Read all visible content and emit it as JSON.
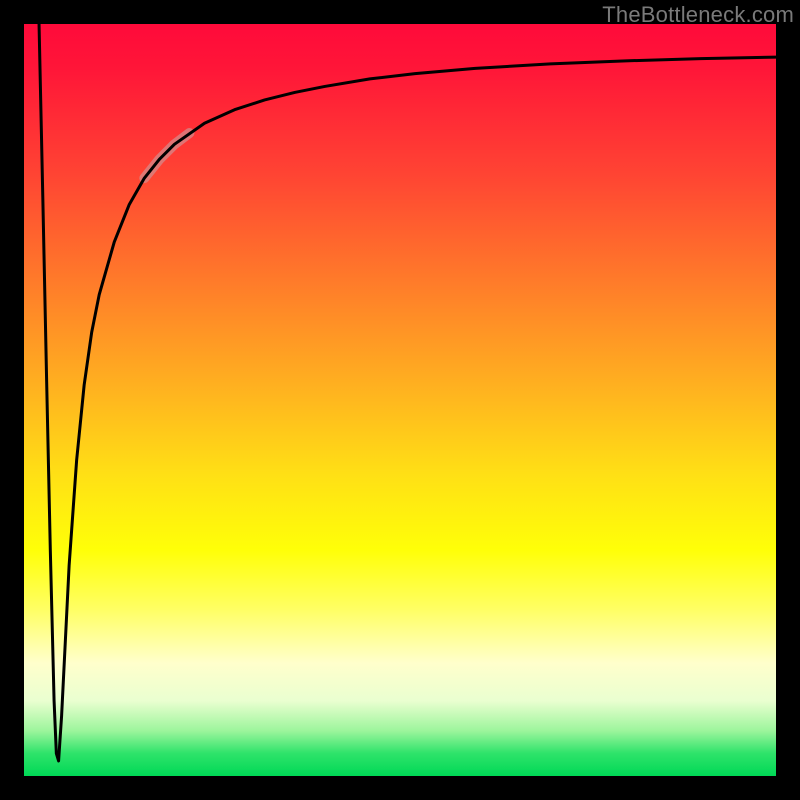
{
  "watermark": "TheBottleneck.com",
  "chart_data": {
    "type": "line",
    "title": "",
    "xlabel": "",
    "ylabel": "",
    "xlim": [
      0,
      100
    ],
    "ylim": [
      0,
      100
    ],
    "grid": false,
    "legend": false,
    "background_gradient": {
      "orientation": "vertical",
      "stops": [
        {
          "pos": 0.0,
          "color": "#ff0a3a"
        },
        {
          "pos": 0.2,
          "color": "#ff4433"
        },
        {
          "pos": 0.4,
          "color": "#ff9a26"
        },
        {
          "pos": 0.6,
          "color": "#ffe015"
        },
        {
          "pos": 0.75,
          "color": "#ffff40"
        },
        {
          "pos": 0.88,
          "color": "#f4ffd8"
        },
        {
          "pos": 0.95,
          "color": "#7af08c"
        },
        {
          "pos": 1.0,
          "color": "#00d856"
        }
      ]
    },
    "series": [
      {
        "name": "bottleneck-curve",
        "color": "#000000",
        "stroke_width": 3,
        "x": [
          2.0,
          2.5,
          3.0,
          3.5,
          4.0,
          4.3,
          4.6,
          5.0,
          5.5,
          6.0,
          7.0,
          8.0,
          9.0,
          10.0,
          12.0,
          14.0,
          16.0,
          18.0,
          20.0,
          24.0,
          28.0,
          32.0,
          36.0,
          40.0,
          46.0,
          52.0,
          60.0,
          70.0,
          80.0,
          90.0,
          100.0
        ],
        "y": [
          100.0,
          77.0,
          53.0,
          30.0,
          10.0,
          3.0,
          2.0,
          8.0,
          18.0,
          28.0,
          42.0,
          52.0,
          59.0,
          64.0,
          71.0,
          76.0,
          79.5,
          82.0,
          84.0,
          86.8,
          88.6,
          89.9,
          90.9,
          91.7,
          92.7,
          93.4,
          94.1,
          94.7,
          95.1,
          95.4,
          95.6
        ]
      },
      {
        "name": "highlight-segment",
        "color": "#d48a8a",
        "stroke_width": 10,
        "x": [
          16.0,
          18.0,
          20.0,
          22.0
        ],
        "y": [
          79.5,
          82.0,
          84.0,
          85.5
        ]
      }
    ],
    "annotations": [
      {
        "text": "TheBottleneck.com",
        "position": "top-right",
        "color": "#7a7a7a"
      }
    ]
  }
}
